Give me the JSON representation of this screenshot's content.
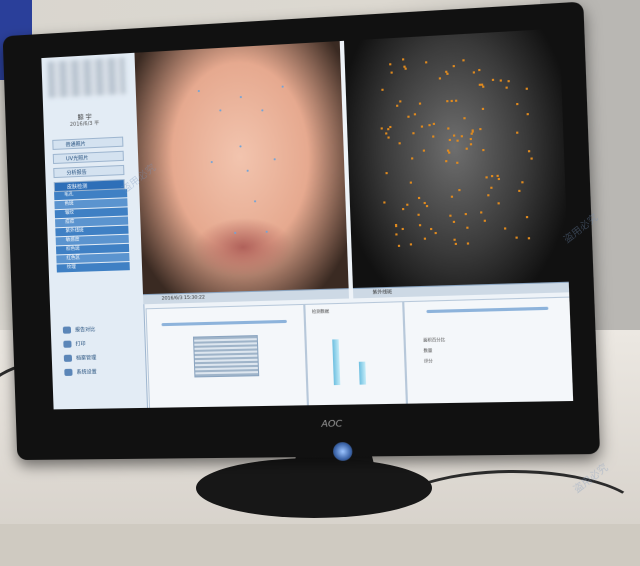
{
  "monitor": {
    "brand": "AOC"
  },
  "app": {
    "user_name": "鲸 宇",
    "user_date": "2016/6/3  平"
  },
  "sidebar": {
    "buttons": [
      "普通照片",
      "UV光照片",
      "分析报告",
      "皮肤检测"
    ],
    "list_items": [
      "毛孔",
      "色斑",
      "皱纹",
      "痘痘",
      "紫外线斑",
      "敏感度",
      "棕色斑",
      "红色区",
      "纹理"
    ],
    "bottom_items": [
      "报告对比",
      "打印",
      "档案管理",
      "系统设置"
    ]
  },
  "panels": {
    "left_toolbar": "2016/6/3 15:30:22",
    "right_toolbar": "紫外线斑"
  },
  "bottom": {
    "left_label": "2016/6/3 15:30:22",
    "mid_label": "检测数据",
    "stats": [
      "面积百分比",
      "数量",
      "评分"
    ]
  },
  "watermarks": [
    "盗用必究",
    "盗用必究",
    "盗用必究"
  ]
}
